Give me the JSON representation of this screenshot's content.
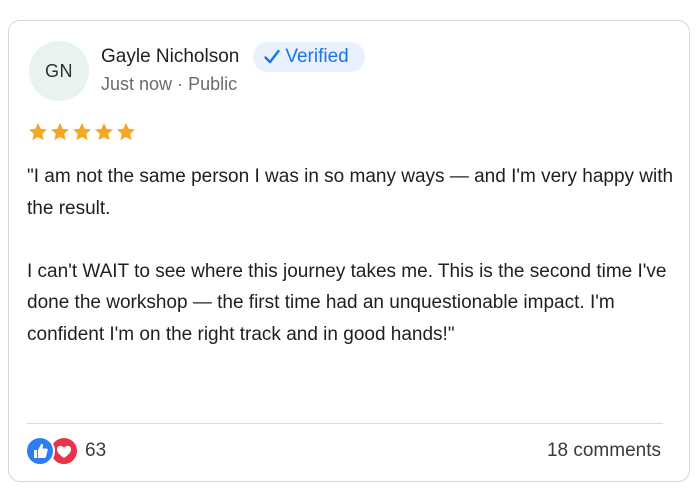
{
  "author": {
    "initials": "GN",
    "name": "Gayle Nicholson",
    "badge": "Verified",
    "time": "Just now",
    "separator": "·",
    "visibility": "Public"
  },
  "rating": {
    "stars": 5,
    "max": 5,
    "color": "#f5a623"
  },
  "review": {
    "paragraphs": [
      "\"I am not the same person I was in so many ways — and I'm very happy with the result.",
      "I can't WAIT to see where this journey takes me. This is the second time I've done the workshop — the first time had an unquestionable impact. I'm confident I'm on the right track and in good hands!\""
    ]
  },
  "footer": {
    "reaction_icons": [
      "like-icon",
      "love-icon"
    ],
    "reaction_count": "63",
    "comments_label": "18 comments"
  },
  "colors": {
    "accent": "#1a73e8",
    "badge_bg": "#e8f1fd",
    "avatar_bg": "#e7f3ec",
    "like": "#2e7ef2",
    "love": "#e8344a"
  }
}
